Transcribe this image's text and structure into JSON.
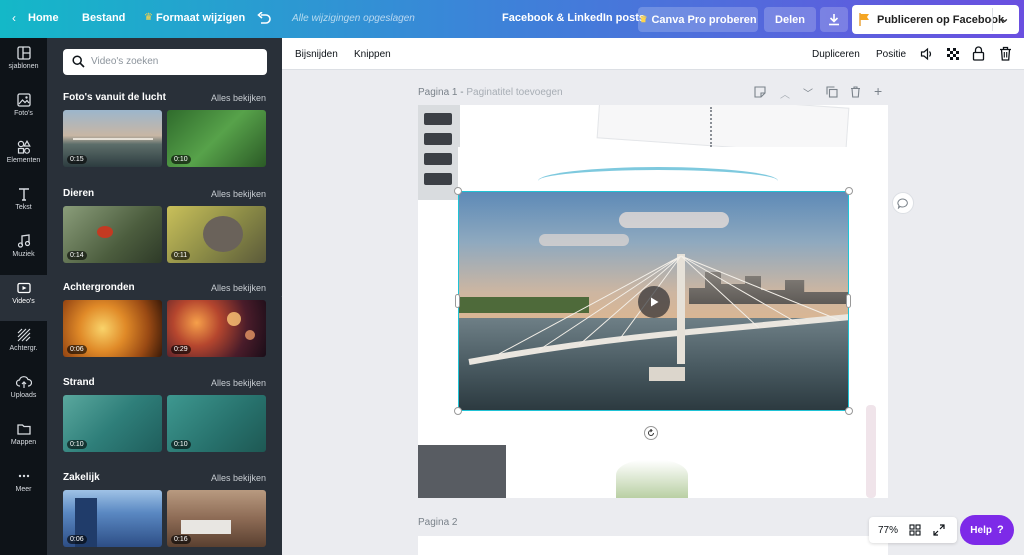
{
  "topbar": {
    "home": "Home",
    "file": "Bestand",
    "resize": "Formaat wijzigen",
    "saved_status": "Alle wijzigingen opgeslagen",
    "design_title": "Facebook & LinkedIn posts",
    "canva_pro": "Canva Pro proberen",
    "share": "Delen",
    "publish": "Publiceren op Facebook"
  },
  "rail": {
    "items": [
      "sjablonen",
      "Foto's",
      "Elementen",
      "Tekst",
      "Muziek",
      "Video's",
      "Achtergr.",
      "Uploads",
      "Mappen",
      "Meer"
    ]
  },
  "panel": {
    "search_placeholder": "Video's zoeken",
    "see_all": "Alles bekijken",
    "sections": [
      {
        "title": "Foto's vanuit de lucht",
        "durations": [
          "0:15",
          "0:10"
        ]
      },
      {
        "title": "Dieren",
        "durations": [
          "0:14",
          "0:11"
        ]
      },
      {
        "title": "Achtergronden",
        "durations": [
          "0:06",
          "0:29"
        ]
      },
      {
        "title": "Strand",
        "durations": [
          "0:10",
          "0:10"
        ]
      },
      {
        "title": "Zakelijk",
        "durations": [
          "0:06",
          "0:16"
        ]
      }
    ]
  },
  "toolbar": {
    "crop": "Bijsnijden",
    "trim": "Knippen",
    "duplicate": "Dupliceren",
    "position": "Positie"
  },
  "canvas": {
    "page1_label": "Pagina 1 - ",
    "page1_title_placeholder": "Paginatitel toevoegen",
    "page2_label": "Pagina 2",
    "zoom": "77%",
    "help": "Help",
    "help_symbol": "?"
  },
  "colors": {
    "accent_purple": "#7d2ae8",
    "selection": "#1fc3d6",
    "dark_panel": "#293039"
  }
}
